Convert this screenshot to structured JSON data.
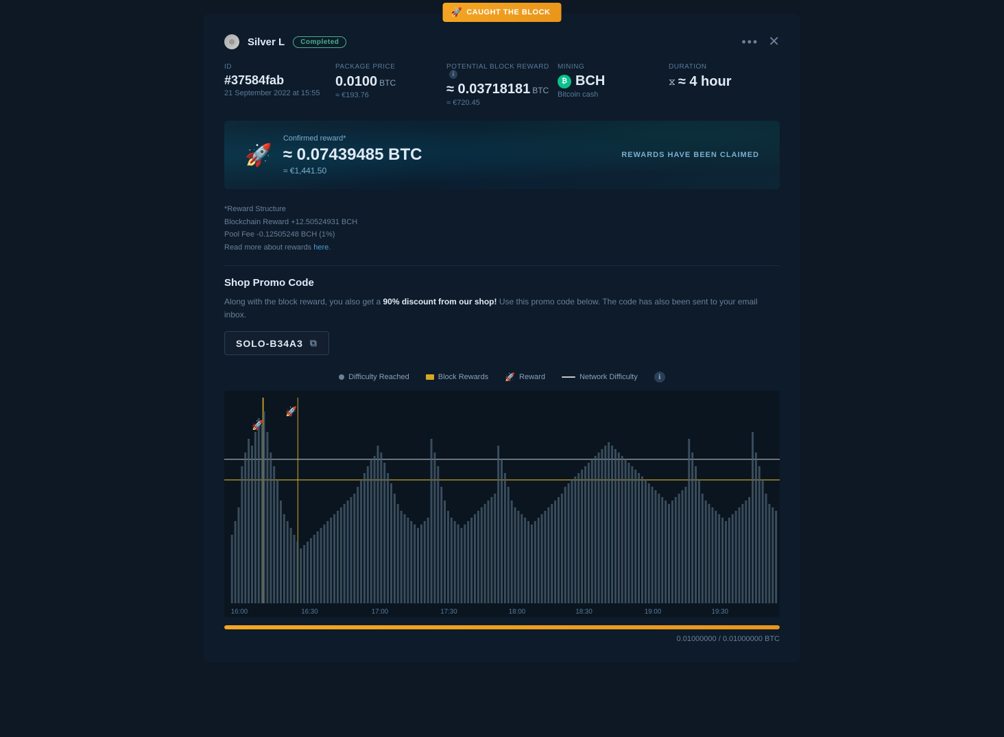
{
  "modal": {
    "top_badge": {
      "icon": "🚀",
      "text": "Caught the BLOCK"
    },
    "header": {
      "account_icon": "●",
      "account_name": "Silver L",
      "status": "Completed",
      "dots_label": "•••",
      "close_label": "✕"
    },
    "info": {
      "id_label": "ID",
      "id_value": "#37584fab",
      "id_date": "21 September 2022 at 15:55",
      "package_label": "Package Price",
      "package_value": "0.0100",
      "package_unit": "BTC",
      "package_eur": "≈ €193.76",
      "potential_label": "Potential Block Reward",
      "potential_value": "≈ 0.03718181",
      "potential_unit": "BTC",
      "potential_eur": "≈ €720.45",
      "mining_label": "Mining",
      "mining_currency": "BCH",
      "mining_name": "Bitcoin cash",
      "duration_label": "Duration",
      "duration_value": "≈ 4 hour"
    },
    "reward_banner": {
      "rocket": "🚀",
      "label": "Confirmed reward*",
      "amount": "≈ 0.07439485 BTC",
      "eur": "≈ €1,441.50",
      "claimed": "REWARDS HAVE BEEN CLAIMED"
    },
    "reward_structure": {
      "title": "*Reward Structure",
      "blockchain": "Blockchain Reward +12.50524931 BCH",
      "pool_fee": "Pool Fee -0.12505248 BCH (1%)",
      "read_more_text": "Read more about rewards ",
      "read_more_link": "here",
      "read_more_end": "."
    },
    "promo": {
      "title": "Shop Promo Code",
      "desc_start": "Along with the block reward, you also get a ",
      "desc_bold": "90% discount from our shop!",
      "desc_end": " Use this promo code below. The code has also been sent to your email inbox.",
      "code": "SOLO-B34A3",
      "copy_icon": "⧉"
    },
    "chart": {
      "legend": {
        "difficulty_reached_label": "Difficulty Reached",
        "difficulty_reached_color": "#6a7f9a",
        "block_rewards_label": "Block Rewards",
        "block_rewards_color": "#d4a820",
        "reward_label": "Reward",
        "network_difficulty_label": "Network Difficulty",
        "info_label": "ℹ"
      },
      "x_labels": [
        "16:00",
        "16:30",
        "17:00",
        "17:30",
        "18:00",
        "18:30",
        "19:00",
        "19:30"
      ],
      "horizontal_line_y": 0.28,
      "orange_line_y": 0.38
    },
    "progress": {
      "value": "0.01000000 / 0.01000000 BTC",
      "percent": 100
    }
  }
}
